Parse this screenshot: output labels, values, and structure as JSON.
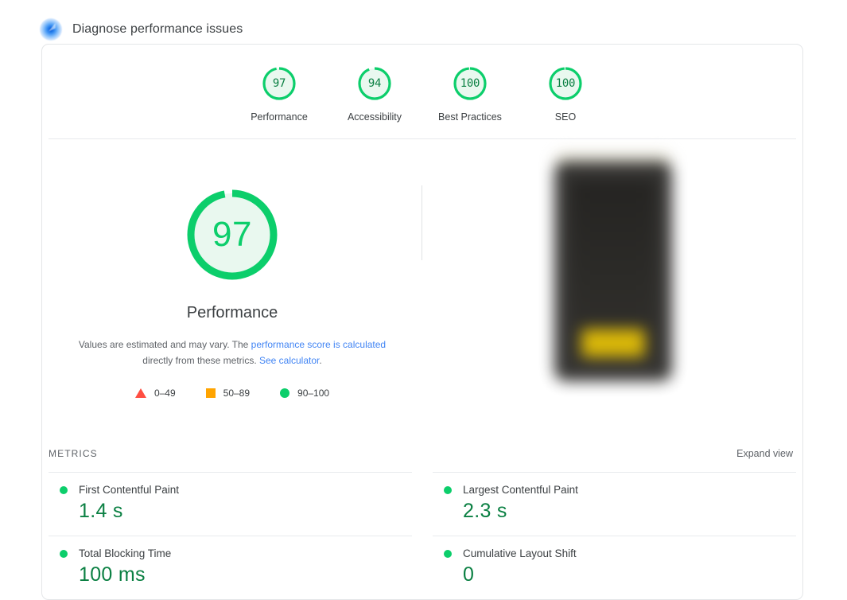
{
  "header": {
    "icon": "lighthouse-icon",
    "title": "Diagnose performance issues"
  },
  "scores": [
    {
      "value": "97",
      "label": "Performance",
      "pct": 97
    },
    {
      "value": "94",
      "label": "Accessibility",
      "pct": 94
    },
    {
      "value": "100",
      "label": "Best Practices",
      "pct": 100
    },
    {
      "value": "100",
      "label": "SEO",
      "pct": 100
    }
  ],
  "gauge": {
    "value": "97",
    "title": "Performance",
    "pct": 97,
    "desc_part1": "Values are estimated and may vary. The ",
    "desc_link1": "performance score is calculated",
    "desc_part2": " directly from these metrics. ",
    "desc_link2": "See calculator",
    "desc_part3": "."
  },
  "legend": [
    {
      "symbol": "triangle",
      "range": "0–49",
      "color": "#ff4e42"
    },
    {
      "symbol": "square",
      "range": "50–89",
      "color": "#ffa400"
    },
    {
      "symbol": "circle",
      "range": "90–100",
      "color": "#0cce6b"
    }
  ],
  "metrics_section": {
    "label": "METRICS",
    "expand_label": "Expand view"
  },
  "metrics": [
    {
      "name": "First Contentful Paint",
      "value": "1.4 s",
      "status": "good"
    },
    {
      "name": "Largest Contentful Paint",
      "value": "2.3 s",
      "status": "good"
    },
    {
      "name": "Total Blocking Time",
      "value": "100 ms",
      "status": "good"
    },
    {
      "name": "Cumulative Layout Shift",
      "value": "0",
      "status": "good"
    }
  ],
  "screenshot": {
    "name": "page-screenshot-thumbnail",
    "blurred": true
  },
  "colors": {
    "good": "#0cce6b",
    "good_text": "#0b8043",
    "average": "#ffa400",
    "poor": "#ff4e42",
    "link": "#4285f4"
  }
}
